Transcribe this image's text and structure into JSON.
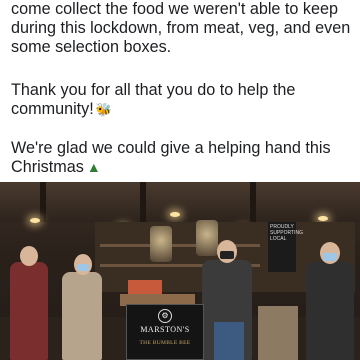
{
  "post": {
    "clipped_line": "come collect the food we weren't able to keep",
    "paragraph1": [
      "during this lockdown, from meat, veg, and even",
      "some selection boxes."
    ],
    "paragraph2": [
      "Thank you for all that you do to help the",
      "community!"
    ],
    "paragraph3": [
      "We're glad we could give a helping hand this",
      "Christmas"
    ],
    "emoji_bee": "🐝",
    "emoji_tree": "▲"
  },
  "photo": {
    "sign_name": "MARSTON'S",
    "sign_subtitle": "THE BUMBLE BEE",
    "board_text": "PROUDLY SUPPORTING LOCAL"
  },
  "colors": {
    "text": "#1c1e21",
    "background": "#ffffff",
    "tree": "#2e7d32"
  }
}
